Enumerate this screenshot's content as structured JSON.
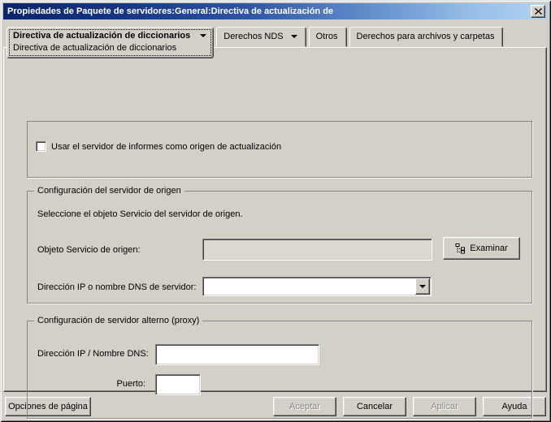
{
  "window": {
    "title": "Propiedades de Paquete de servidores:General:Directiva de actualización de"
  },
  "colors": {
    "titlebar_gradient_start": "#0a246a",
    "titlebar_gradient_end": "#b2d4f2",
    "dialog_background": "#d4d0c8",
    "disabled_text": "#868686",
    "disabled_field_background": "#dcd9d2"
  },
  "icons": {
    "close": "close-x",
    "tab_dropdown": "triangle-down",
    "combo_dropdown": "triangle-down",
    "browse": "tree-browse"
  },
  "tabs": {
    "active": {
      "label": "Directiva de actualización de diccionarios",
      "sublabel": "Directiva de actualización de diccionarios",
      "has_dropdown": true
    },
    "others": [
      {
        "label": "Derechos NDS",
        "has_dropdown": true
      },
      {
        "label": "Otros",
        "has_dropdown": false
      },
      {
        "label": "Derechos para archivos y carpetas",
        "has_dropdown": false
      }
    ]
  },
  "content": {
    "report_checkbox": {
      "label": "Usar el servidor de informes como origen de actualización",
      "checked": false
    },
    "source_group": {
      "title": "Configuración del servidor de origen",
      "instruction": "Seleccione el objeto Servicio del servidor de origen.",
      "object_label": "Objeto Servicio de origen:",
      "object_value": "",
      "browse_button": "Examinar",
      "address_label": "Dirección IP o nombre DNS de servidor:",
      "address_value": ""
    },
    "proxy_group": {
      "title": "Configuración de servidor alterno (proxy)",
      "address_label": "Dirección IP / Nombre DNS:",
      "address_value": "",
      "port_label": "Puerto:",
      "port_value": ""
    }
  },
  "footer": {
    "page_options": "Opciones de página",
    "ok": "Aceptar",
    "cancel": "Cancelar",
    "apply": "Aplicar",
    "help": "Ayuda"
  }
}
